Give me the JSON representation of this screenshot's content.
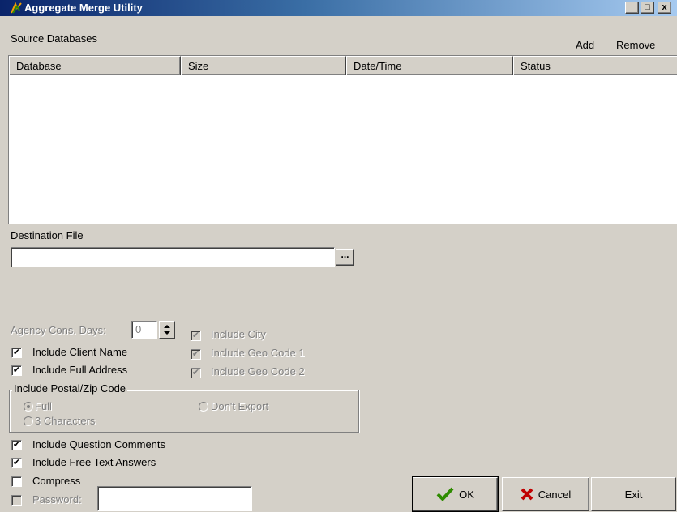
{
  "window": {
    "title": "Aggregate Merge Utility",
    "buttons": {
      "minimize": "_",
      "maximize": "□",
      "close": "x"
    }
  },
  "source": {
    "label": "Source Databases",
    "add_label": "Add",
    "remove_label": "Remove",
    "columns": [
      "Database",
      "Size",
      "Date/Time",
      "Status"
    ],
    "rows": []
  },
  "destination": {
    "label": "Destination File",
    "value": "",
    "browse_label": "..."
  },
  "agency": {
    "label": "Agency Cons. Days:",
    "value": "0"
  },
  "checks": {
    "client_name": "Include Client Name",
    "full_address": "Include Full Address",
    "city": "Include City",
    "geo1": "Include Geo Code 1",
    "geo2": "Include Geo Code 2",
    "question_comments": "Include Question Comments",
    "free_text": "Include Free Text Answers",
    "compress": "Compress",
    "password": "Password:"
  },
  "postal": {
    "title": "Include Postal/Zip Code",
    "full": "Full",
    "three_chars": "3 Characters",
    "dont_export": "Don't Export"
  },
  "password_value": "",
  "actions": {
    "ok": "OK",
    "cancel": "Cancel",
    "exit": "Exit"
  },
  "colors": {
    "titlebar_start": "#0a246a",
    "titlebar_end": "#a6caf0",
    "face": "#d4d0c8",
    "ok_check": "#2e8b00",
    "cancel_x": "#c00000"
  }
}
